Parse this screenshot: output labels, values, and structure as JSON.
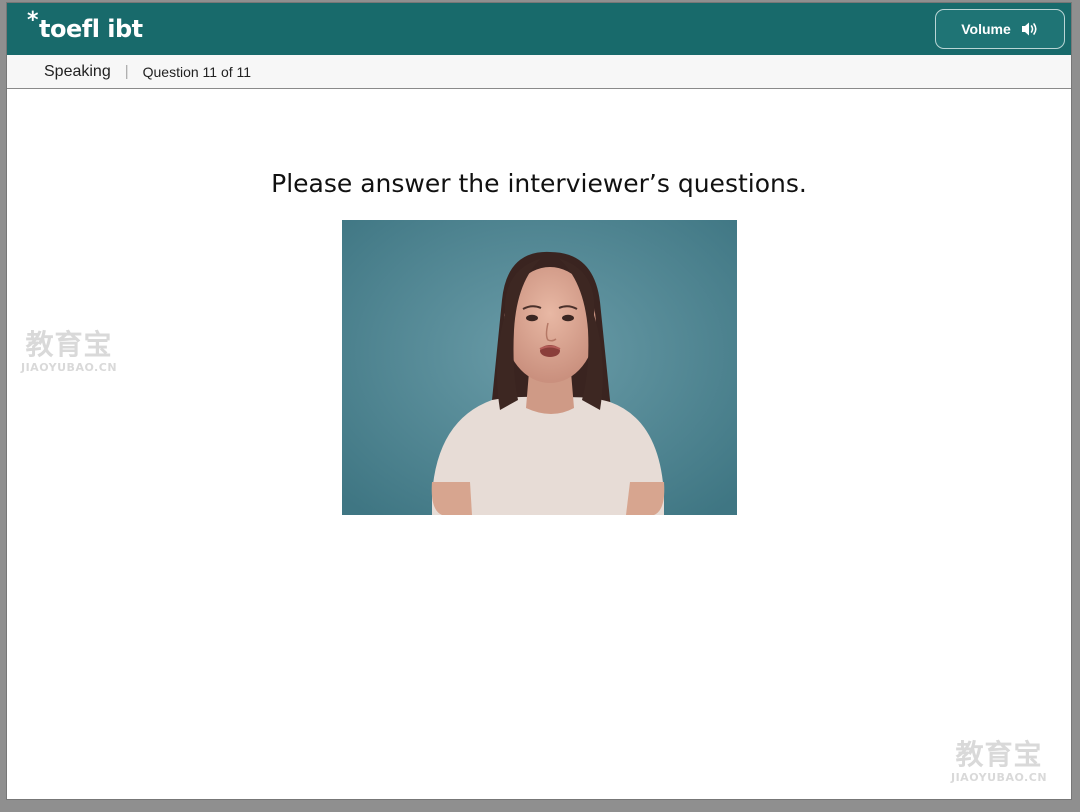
{
  "header": {
    "logo_star": "*",
    "logo_text": "toefl ibt",
    "volume_label": "Volume",
    "volume_icon": "speaker-volume-icon"
  },
  "subheader": {
    "section": "Speaking",
    "separator": "|",
    "question_counter": "Question 11 of 11"
  },
  "main": {
    "prompt": "Please answer the interviewer’s questions.",
    "video_subject": "interviewer-video"
  },
  "watermarks": [
    {
      "cn": "教育宝",
      "en": "JIAOYUBAO.CN"
    },
    {
      "cn": "教育宝",
      "en": "JIAOYUBAO.CN"
    }
  ],
  "colors": {
    "header_bg": "#186a6b",
    "subbar_bg": "#f7f7f7",
    "video_backdrop": "#4f8a96"
  }
}
